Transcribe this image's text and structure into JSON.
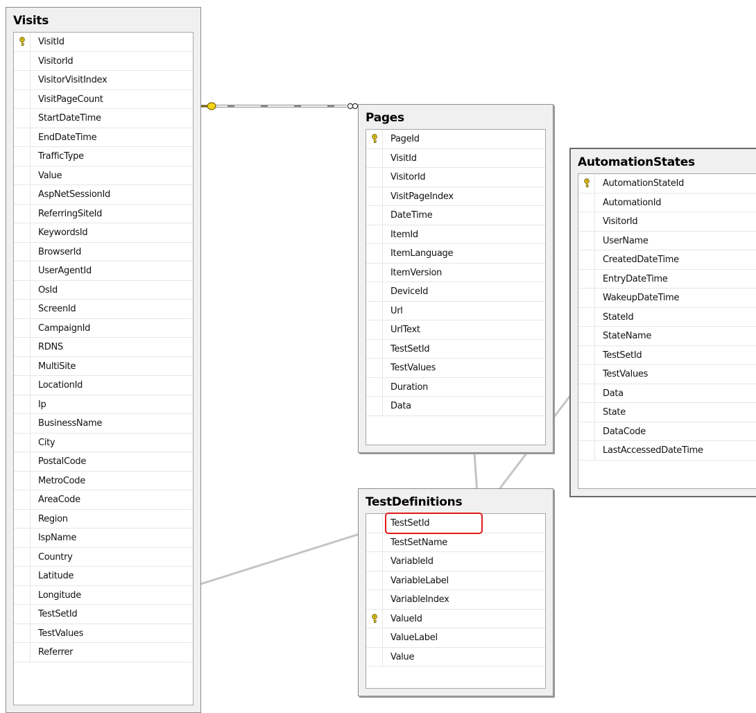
{
  "tables": {
    "visits": {
      "title": "Visits",
      "columns": [
        {
          "name": "VisitId",
          "key": true
        },
        {
          "name": "VisitorId",
          "key": false
        },
        {
          "name": "VisitorVisitIndex",
          "key": false
        },
        {
          "name": "VisitPageCount",
          "key": false
        },
        {
          "name": "StartDateTime",
          "key": false
        },
        {
          "name": "EndDateTime",
          "key": false
        },
        {
          "name": "TrafficType",
          "key": false
        },
        {
          "name": "Value",
          "key": false
        },
        {
          "name": "AspNetSessionId",
          "key": false
        },
        {
          "name": "ReferringSiteId",
          "key": false
        },
        {
          "name": "KeywordsId",
          "key": false
        },
        {
          "name": "BrowserId",
          "key": false
        },
        {
          "name": "UserAgentId",
          "key": false
        },
        {
          "name": "OsId",
          "key": false
        },
        {
          "name": "ScreenId",
          "key": false
        },
        {
          "name": "CampaignId",
          "key": false
        },
        {
          "name": "RDNS",
          "key": false
        },
        {
          "name": "MultiSite",
          "key": false
        },
        {
          "name": "LocationId",
          "key": false
        },
        {
          "name": "Ip",
          "key": false
        },
        {
          "name": "BusinessName",
          "key": false
        },
        {
          "name": "City",
          "key": false
        },
        {
          "name": "PostalCode",
          "key": false
        },
        {
          "name": "MetroCode",
          "key": false
        },
        {
          "name": "AreaCode",
          "key": false
        },
        {
          "name": "Region",
          "key": false
        },
        {
          "name": "IspName",
          "key": false
        },
        {
          "name": "Country",
          "key": false
        },
        {
          "name": "Latitude",
          "key": false
        },
        {
          "name": "Longitude",
          "key": false
        },
        {
          "name": "TestSetId",
          "key": false
        },
        {
          "name": "TestValues",
          "key": false
        },
        {
          "name": "Referrer",
          "key": false
        }
      ]
    },
    "pages": {
      "title": "Pages",
      "columns": [
        {
          "name": "PageId",
          "key": true
        },
        {
          "name": "VisitId",
          "key": false
        },
        {
          "name": "VisitorId",
          "key": false
        },
        {
          "name": "VisitPageIndex",
          "key": false
        },
        {
          "name": "DateTime",
          "key": false
        },
        {
          "name": "ItemId",
          "key": false
        },
        {
          "name": "ItemLanguage",
          "key": false
        },
        {
          "name": "ItemVersion",
          "key": false
        },
        {
          "name": "DeviceId",
          "key": false
        },
        {
          "name": "Url",
          "key": false
        },
        {
          "name": "UrlText",
          "key": false
        },
        {
          "name": "TestSetId",
          "key": false
        },
        {
          "name": "TestValues",
          "key": false
        },
        {
          "name": "Duration",
          "key": false
        },
        {
          "name": "Data",
          "key": false
        }
      ]
    },
    "automation_states": {
      "title": "AutomationStates",
      "columns": [
        {
          "name": "AutomationStateId",
          "key": true
        },
        {
          "name": "AutomationId",
          "key": false
        },
        {
          "name": "VisitorId",
          "key": false
        },
        {
          "name": "UserName",
          "key": false
        },
        {
          "name": "CreatedDateTime",
          "key": false
        },
        {
          "name": "EntryDateTime",
          "key": false
        },
        {
          "name": "WakeupDateTime",
          "key": false
        },
        {
          "name": "StateId",
          "key": false
        },
        {
          "name": "StateName",
          "key": false
        },
        {
          "name": "TestSetId",
          "key": false
        },
        {
          "name": "TestValues",
          "key": false
        },
        {
          "name": "Data",
          "key": false
        },
        {
          "name": "State",
          "key": false
        },
        {
          "name": "DataCode",
          "key": false
        },
        {
          "name": "LastAccessedDateTime",
          "key": false
        }
      ]
    },
    "test_definitions": {
      "title": "TestDefinitions",
      "columns": [
        {
          "name": "TestSetId",
          "key": false
        },
        {
          "name": "TestSetName",
          "key": false
        },
        {
          "name": "VariableId",
          "key": false
        },
        {
          "name": "VariableLabel",
          "key": false
        },
        {
          "name": "VariableIndex",
          "key": false
        },
        {
          "name": "ValueId",
          "key": true
        },
        {
          "name": "ValueLabel",
          "key": false
        },
        {
          "name": "Value",
          "key": false
        }
      ]
    }
  },
  "colors": {
    "key_icon": "#f2d21b",
    "highlight": "#e01b1b",
    "arrow": "#c0c0c0"
  },
  "icons": {
    "primary_key": "key-icon",
    "relationship_one": "key-icon",
    "relationship_many": "infinity-icon"
  }
}
